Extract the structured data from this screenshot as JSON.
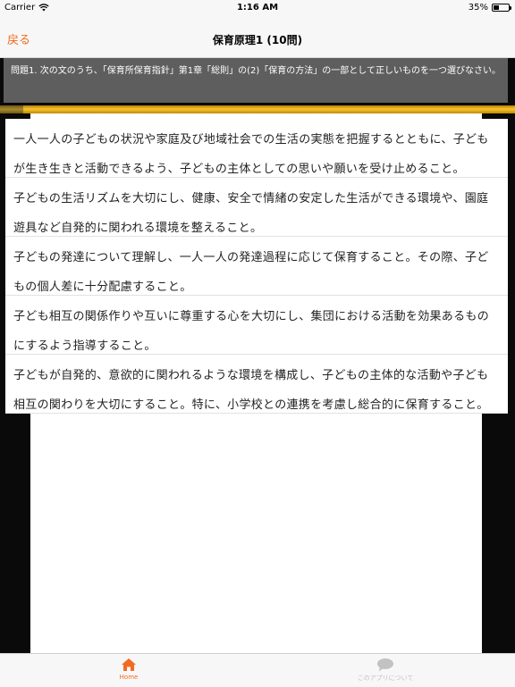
{
  "status_bar": {
    "carrier": "Carrier",
    "time": "1:16 AM",
    "battery": "35%",
    "battery_level": 0.35
  },
  "nav": {
    "back_label": "戻る",
    "title": "保育原理1 (10問)"
  },
  "question": {
    "text": "問題1. 次の文のうち、「保育所保育指針」第1章「総則」の(2)「保育の方法」の一部として正しいものを一つ選びなさい。"
  },
  "options": [
    {
      "text": "一人一人の子どもの状況や家庭及び地域社会での生活の実態を把握するとともに、子どもが生き生きと活動できるよう、子どもの主体としての思いや願いを受け止めること。"
    },
    {
      "text": "子どもの生活リズムを大切にし、健康、安全で情緒の安定した生活ができる環境や、園庭遊具など自発的に関われる環境を整えること。"
    },
    {
      "text": "子どもの発達について理解し、一人一人の発達過程に応じて保育すること。その際、子どもの個人差に十分配慮すること。"
    },
    {
      "text": "子ども相互の関係作りや互いに尊重する心を大切にし、集団における活動を効果あるものにするよう指導すること。"
    },
    {
      "text": "子どもが自発的、意欲的に関われるような環境を構成し、子どもの主体的な活動や子ども相互の関わりを大切にすること。特に、小学校との連携を考慮し総合的に保育すること。"
    }
  ],
  "tabs": {
    "home_label": "Home",
    "about_label": "このアプリについて"
  },
  "colors": {
    "accent": "#f26b21",
    "question_bg": "#5e5e5e",
    "progress_gold": "#f7c630"
  },
  "icons": {
    "home": "home-icon",
    "about": "speech-bubble-icon"
  }
}
